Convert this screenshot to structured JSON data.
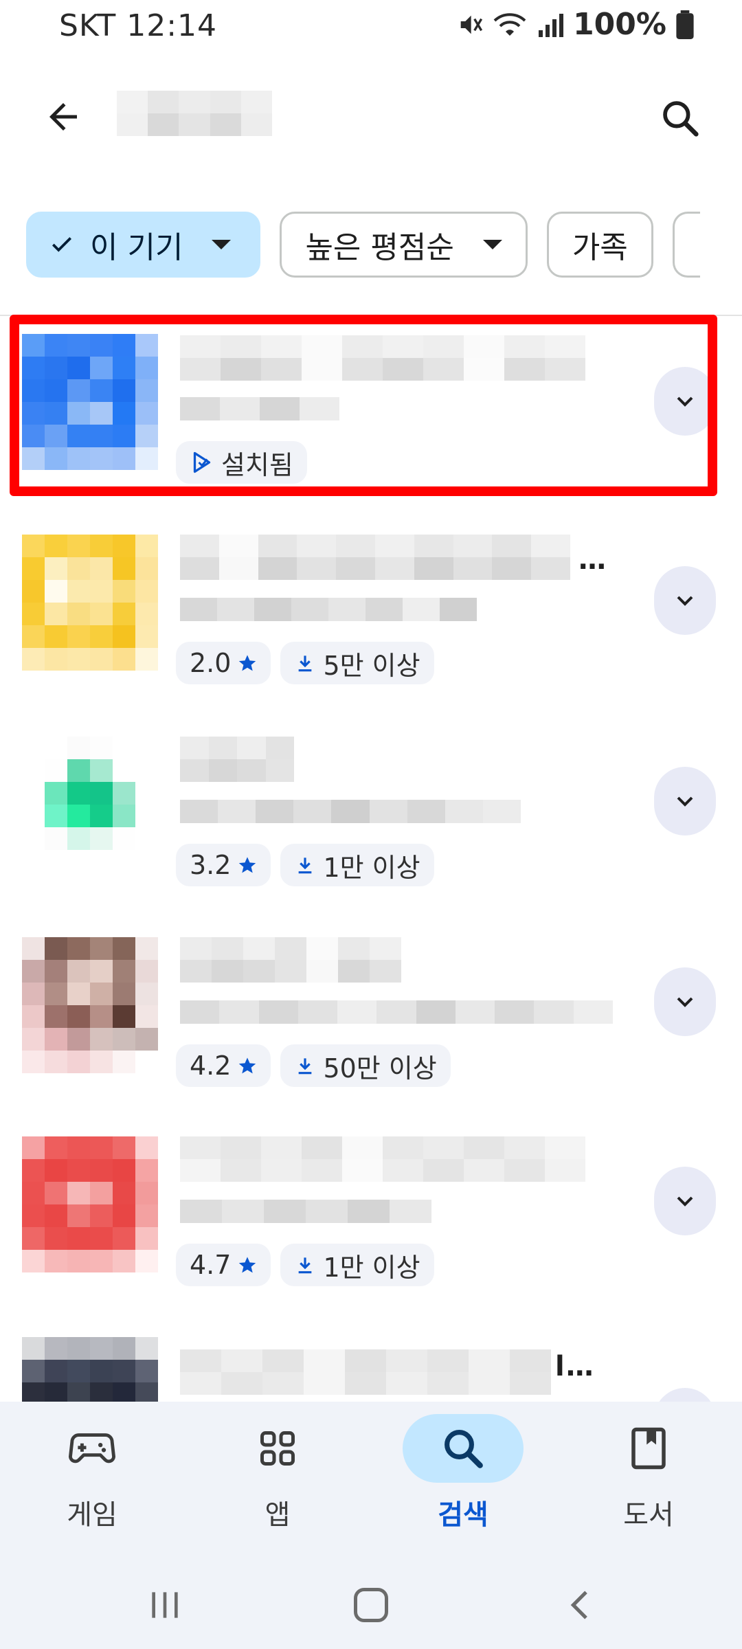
{
  "status_bar": {
    "carrier_time": "SKT 12:14",
    "battery": "100%"
  },
  "top_bar": {
    "search_query": ""
  },
  "filters": [
    {
      "label": "이 기기",
      "selected": true,
      "has_dropdown": true
    },
    {
      "label": "높은 평점순",
      "selected": false,
      "has_dropdown": true
    },
    {
      "label": "가족",
      "selected": false,
      "has_dropdown": false
    }
  ],
  "apps": [
    {
      "status_label": "설치됨",
      "rating": "",
      "downloads": "",
      "installed": true
    },
    {
      "status_label": "",
      "rating": "2.0",
      "downloads": "5만 이상",
      "installed": false
    },
    {
      "status_label": "",
      "rating": "3.2",
      "downloads": "1만 이상",
      "installed": false
    },
    {
      "status_label": "",
      "rating": "4.2",
      "downloads": "50만 이상",
      "installed": false
    },
    {
      "status_label": "",
      "rating": "4.7",
      "downloads": "1만 이상",
      "installed": false
    }
  ],
  "bottom_nav": [
    {
      "label": "게임",
      "icon": "gamepad-icon",
      "active": false
    },
    {
      "label": "앱",
      "icon": "apps-grid-icon",
      "active": false
    },
    {
      "label": "검색",
      "icon": "search-icon",
      "active": true
    },
    {
      "label": "도서",
      "icon": "book-icon",
      "active": false
    }
  ],
  "colors": {
    "accent": "#0b57d0",
    "chip_selected": "#c2e7ff",
    "highlight": "#ff0000"
  }
}
